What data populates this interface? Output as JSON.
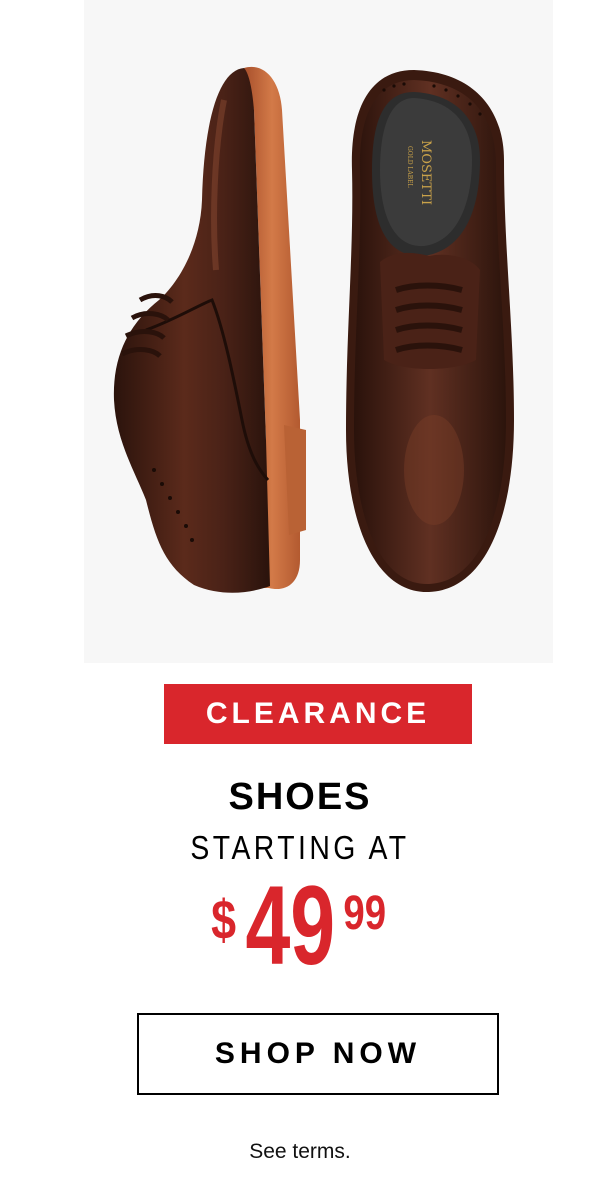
{
  "product_image": {
    "alt_label": "MOSETTI",
    "sub_label": "GOLD LABEL",
    "color_leather": "#4a2217",
    "color_sole": "#c86a3c",
    "background": "#f7f7f7"
  },
  "promo": {
    "badge": "CLEARANCE",
    "category": "SHOES",
    "subheading": "STARTING AT",
    "price": {
      "currency": "$",
      "dollars": "49",
      "cents": "99"
    },
    "cta_label": "SHOP NOW",
    "terms": "See terms."
  },
  "colors": {
    "accent_red": "#d9262c",
    "text": "#000000"
  }
}
